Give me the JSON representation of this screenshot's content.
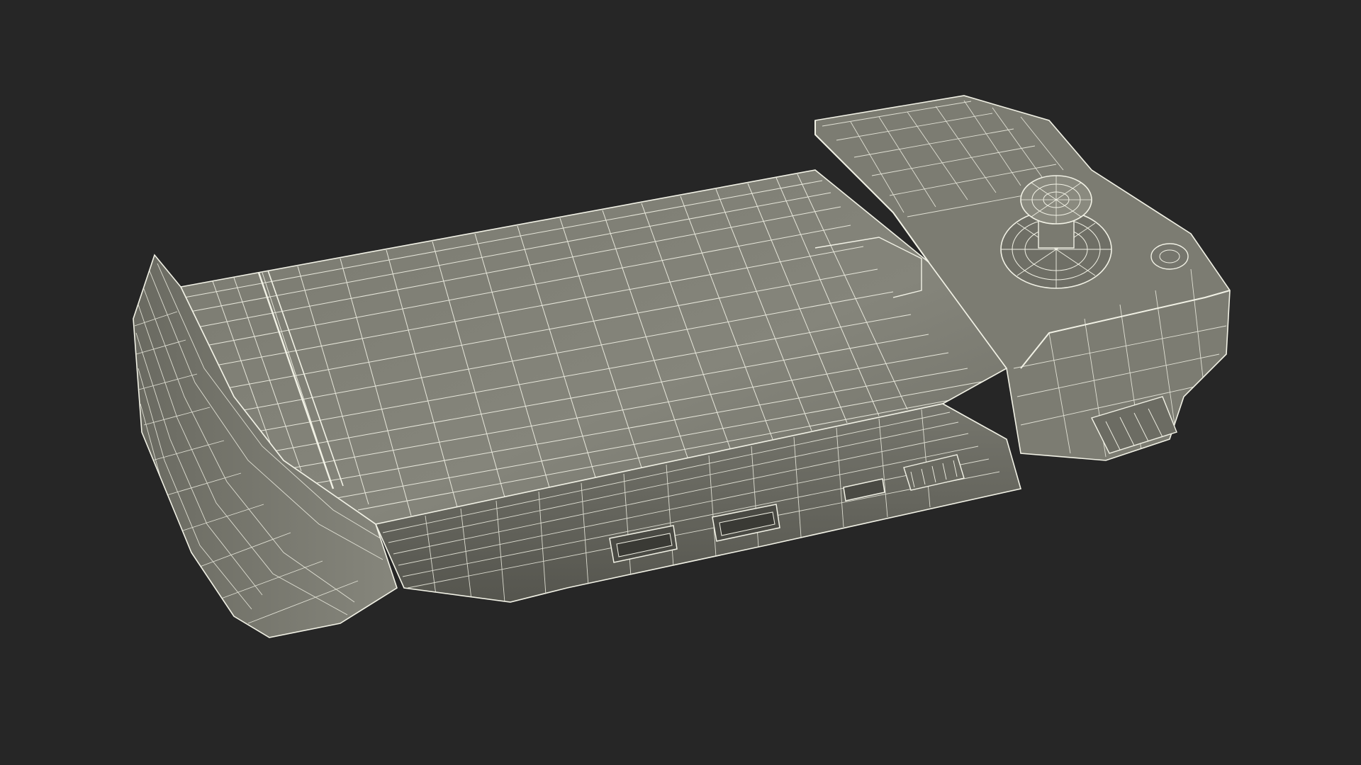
{
  "scene": {
    "background_color": "#262626",
    "subject": "wireframe-render-of-handheld-controller-grip",
    "render_style": "wireframe",
    "wire_color": "#f2f2e6",
    "shade_light": "#8c8c80",
    "shade_mid": "#6f6f66",
    "shade_dark": "#4e4e47"
  }
}
